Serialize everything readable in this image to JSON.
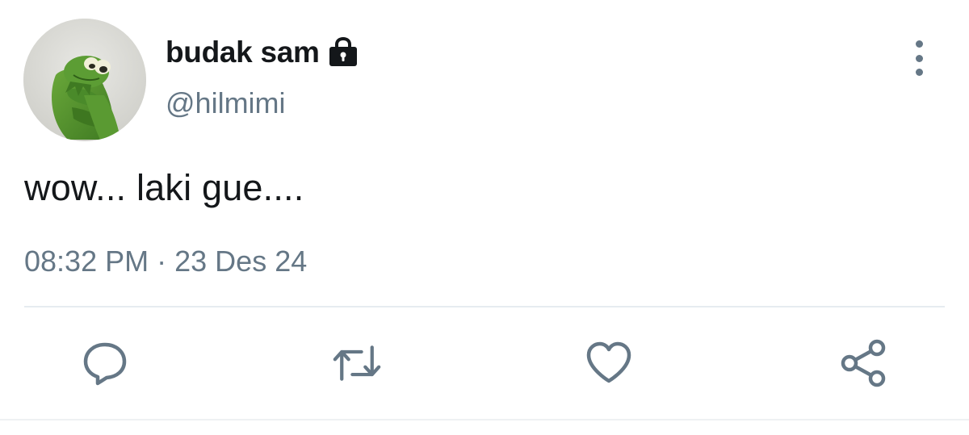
{
  "author": {
    "display_name": "budak sam",
    "handle": "@hilmimi",
    "protected_icon": "lock-icon",
    "avatar": "green-frog-plush-photo"
  },
  "tweet": {
    "text": "wow... laki gue....",
    "time": "08:32 PM",
    "separator": "·",
    "date": "23 Des 24"
  },
  "actions": [
    {
      "name": "reply",
      "icon": "reply-icon"
    },
    {
      "name": "retweet",
      "icon": "retweet-icon"
    },
    {
      "name": "like",
      "icon": "heart-icon"
    },
    {
      "name": "share",
      "icon": "share-icon"
    }
  ],
  "menu": {
    "icon": "more-vertical-icon"
  },
  "colors": {
    "primary_text": "#14171a",
    "secondary_text": "#657786",
    "icon": "#657786",
    "divider": "#e6ecf0",
    "avatar_green": "#4e8a2c"
  }
}
